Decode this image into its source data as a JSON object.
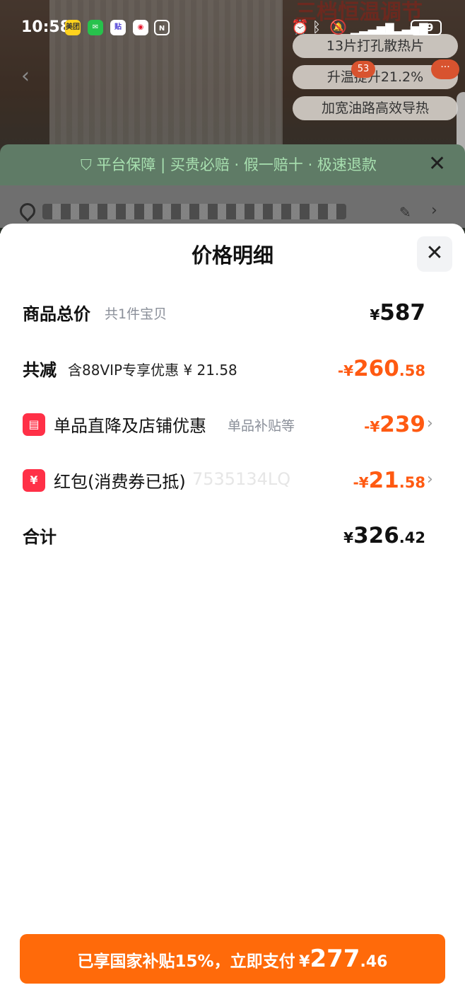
{
  "status_bar": {
    "time": "10:58",
    "apps": [
      "美团",
      "WeChat",
      "贴",
      "微博",
      "N"
    ],
    "battery": "29"
  },
  "background": {
    "title": "三档恒温调节",
    "chips": [
      "13片打孔散热片",
      "升温提升21.2%",
      "加宽油路高效导热"
    ],
    "badge_count": "53",
    "guarantee_text": "平台保障 | 买贵必赔 · 假一赔十 · 极速退款"
  },
  "sheet": {
    "title": "价格明细",
    "rows": {
      "total": {
        "label": "商品总价",
        "sub": "共1件宝贝",
        "currency": "¥",
        "amount": "587"
      },
      "reduction": {
        "label": "共减",
        "note": "含88VIP专享优惠 ¥ 21.58",
        "prefix": "-¥",
        "amount_int": "260",
        "amount_dec": ".58"
      },
      "store_discount": {
        "label": "单品直降及店铺优惠",
        "sub": "单品补贴等",
        "prefix": "-¥",
        "amount": "239"
      },
      "red_packet": {
        "label": "红包(消费券已抵)",
        "ghost_code": "7535134LQ",
        "prefix": "-¥",
        "amount_int": "21",
        "amount_dec": ".58"
      },
      "sum": {
        "label": "合计",
        "currency": "¥",
        "amount_int": "326",
        "amount_dec": ".42"
      }
    }
  },
  "pay_button": {
    "text": "已享国家补贴15%，立即支付",
    "currency": "¥",
    "amount_int": "277",
    "amount_dec": ".46"
  },
  "colors": {
    "accent_orange": "#ff5a12",
    "pay_button": "#ff6a0a",
    "red_icon": "#ff3047"
  }
}
